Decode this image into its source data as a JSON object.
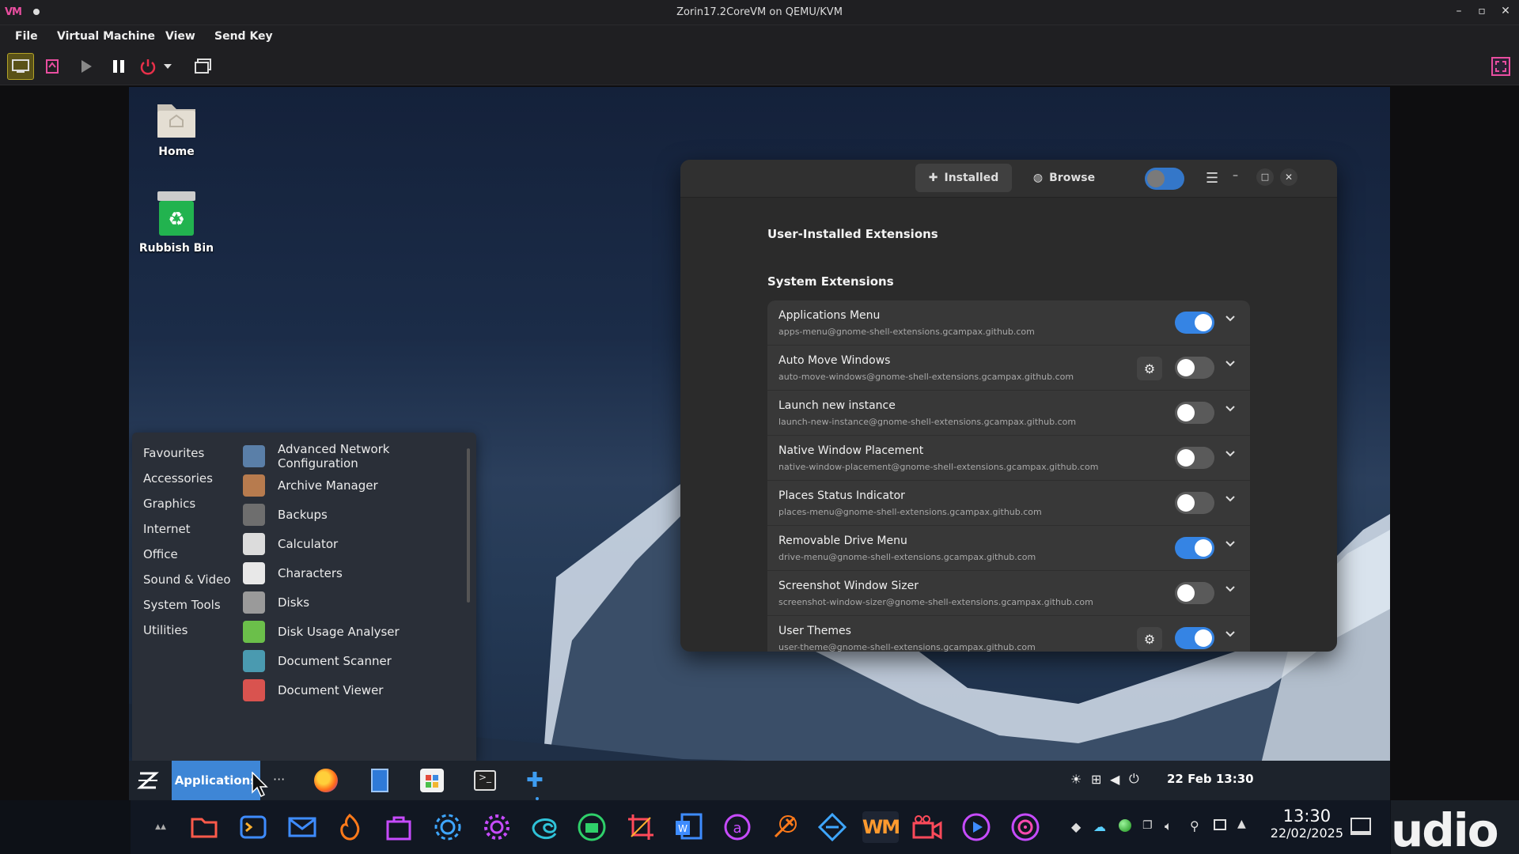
{
  "window": {
    "app_logo": "VM",
    "title": "Zorin17.2CoreVM on QEMU/KVM"
  },
  "menubar": [
    "File",
    "Virtual Machine",
    "View",
    "Send Key"
  ],
  "desktop": {
    "icons": [
      {
        "label": "Home",
        "icon": "folder-home-icon"
      },
      {
        "label": "Rubbish Bin",
        "icon": "recycle-bin-icon"
      }
    ]
  },
  "extensions_window": {
    "tabs": [
      {
        "label": "Installed",
        "icon": "puzzle-icon",
        "selected": true
      },
      {
        "label": "Browse",
        "icon": "globe-icon",
        "selected": false
      }
    ],
    "global_toggle_on": false,
    "section_user": "User-Installed Extensions",
    "section_system": "System Extensions",
    "extensions": [
      {
        "name": "Applications Menu",
        "uuid": "apps-menu@gnome-shell-extensions.gcampax.github.com",
        "enabled": true,
        "has_settings": false
      },
      {
        "name": "Auto Move Windows",
        "uuid": "auto-move-windows@gnome-shell-extensions.gcampax.github.com",
        "enabled": false,
        "has_settings": true
      },
      {
        "name": "Launch new instance",
        "uuid": "launch-new-instance@gnome-shell-extensions.gcampax.github.com",
        "enabled": false,
        "has_settings": false
      },
      {
        "name": "Native Window Placement",
        "uuid": "native-window-placement@gnome-shell-extensions.gcampax.github.com",
        "enabled": false,
        "has_settings": false
      },
      {
        "name": "Places Status Indicator",
        "uuid": "places-menu@gnome-shell-extensions.gcampax.github.com",
        "enabled": false,
        "has_settings": false
      },
      {
        "name": "Removable Drive Menu",
        "uuid": "drive-menu@gnome-shell-extensions.gcampax.github.com",
        "enabled": true,
        "has_settings": false
      },
      {
        "name": "Screenshot Window Sizer",
        "uuid": "screenshot-window-sizer@gnome-shell-extensions.gcampax.github.com",
        "enabled": false,
        "has_settings": false
      },
      {
        "name": "User Themes",
        "uuid": "user-theme@gnome-shell-extensions.gcampax.github.com",
        "enabled": true,
        "has_settings": true
      }
    ]
  },
  "app_menu": {
    "categories": [
      "Favourites",
      "Accessories",
      "Graphics",
      "Internet",
      "Office",
      "Sound & Video",
      "System Tools",
      "Utilities"
    ],
    "apps": [
      {
        "label": "Advanced Network Configuration",
        "color": "#5a7fa8"
      },
      {
        "label": "Archive Manager",
        "color": "#b77b4e"
      },
      {
        "label": "Backups",
        "color": "#6e6e6e"
      },
      {
        "label": "Calculator",
        "color": "#dcdcdc"
      },
      {
        "label": "Characters",
        "color": "#e8e8e8"
      },
      {
        "label": "Disks",
        "color": "#9a9a9a"
      },
      {
        "label": "Disk Usage Analyser",
        "color": "#6bbf4a"
      },
      {
        "label": "Document Scanner",
        "color": "#4a9ab0"
      },
      {
        "label": "Document Viewer",
        "color": "#d9534f"
      }
    ]
  },
  "guest_panel": {
    "apps_button": "Applications",
    "more": "···",
    "clock": "22 Feb  13:30"
  },
  "host_taskbar": {
    "time": "13:30",
    "date": "22/02/2025",
    "studio_text": "udio"
  },
  "colors": {
    "accent": "#3584e4",
    "apps_button": "#3e86d6"
  }
}
